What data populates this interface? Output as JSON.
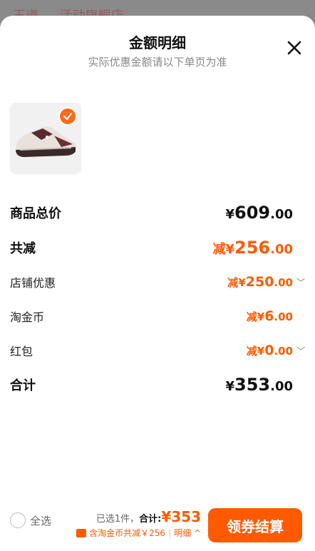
{
  "background": {
    "text": "王道 … 活动旗舰店"
  },
  "header": {
    "title": "金额明细",
    "subtitle": "实际优惠金额请以下单页为准"
  },
  "product": {
    "selected": true
  },
  "rows": {
    "total_price": {
      "label": "商品总价",
      "symbol": "¥",
      "int": "609",
      "dec": ".00"
    },
    "total_discount": {
      "label": "共减",
      "prefix": "减",
      "symbol": "¥",
      "int": "256",
      "dec": ".00"
    },
    "shop_discount": {
      "label": "店铺优惠",
      "prefix": "减",
      "symbol": "¥",
      "int": "250",
      "dec": ".00"
    },
    "taojinbi": {
      "label": "淘金币",
      "prefix": "减",
      "symbol": "¥",
      "int": "6",
      "dec": ".00"
    },
    "hongbao": {
      "label": "红包",
      "prefix": "减",
      "symbol": "¥",
      "int": "0",
      "dec": ".00"
    },
    "grand_total": {
      "label": "合计",
      "symbol": "¥",
      "int": "353",
      "dec": ".00"
    }
  },
  "footer": {
    "select_all": "全选",
    "selected_count": "已选1件，",
    "total_label": "合计:",
    "total_value": "¥353",
    "coin_note": "含淘金币共减￥256",
    "detail_link": "明细",
    "checkout_button": "领券结算"
  },
  "colors": {
    "accent": "#ff5a00",
    "badge": "#ff6a1a"
  }
}
